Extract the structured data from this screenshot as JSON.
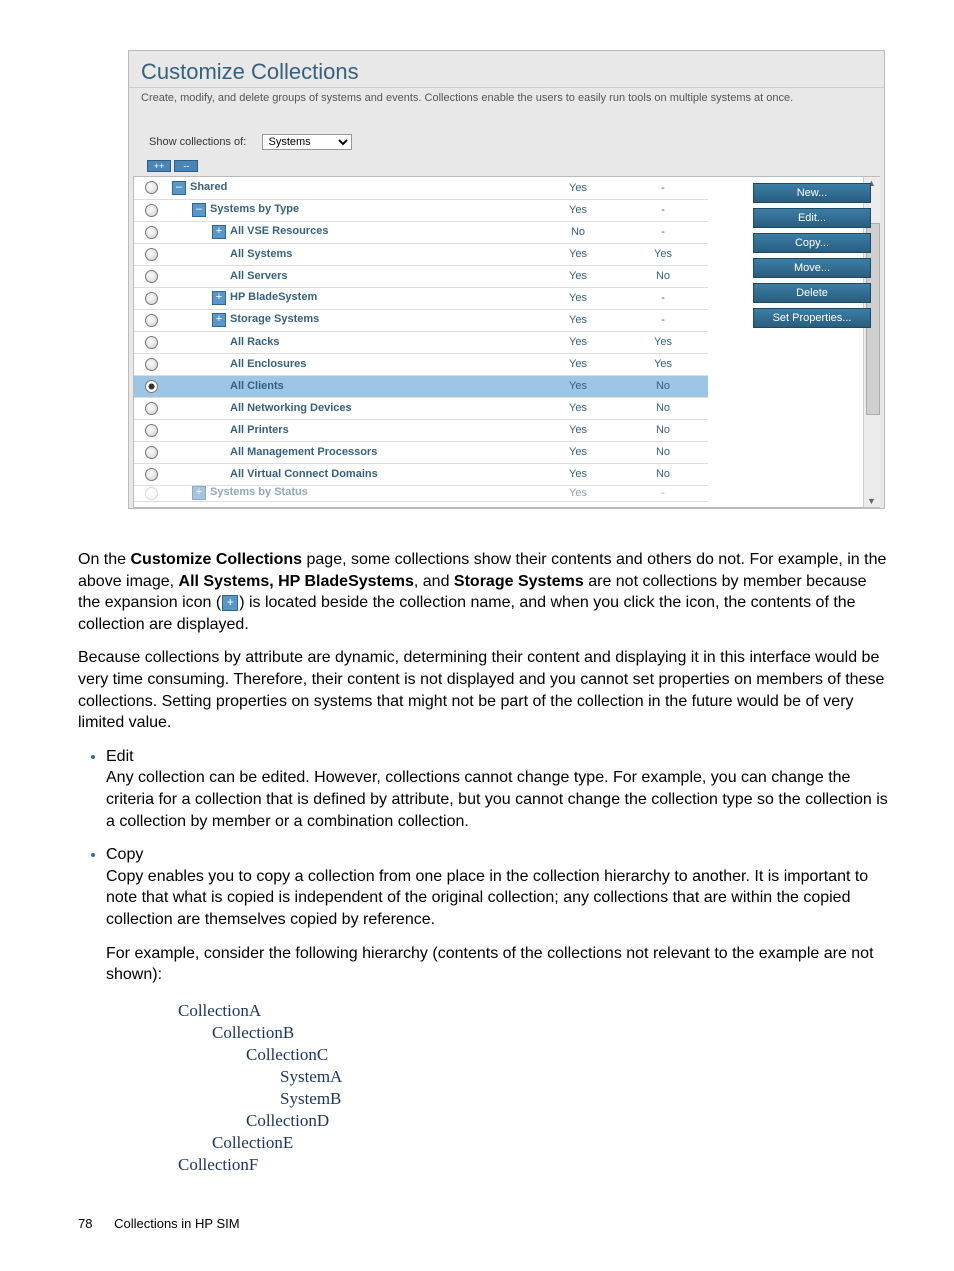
{
  "figure": {
    "title": "Customize Collections",
    "subtitle": "Create, modify, and delete groups of systems and events. Collections enable the users to easily run tools on multiple systems at once.",
    "show_label": "Show collections of:",
    "show_value": "Systems",
    "expand_all": "++",
    "collapse_all": "--",
    "rows": [
      {
        "indent": 0,
        "icon": "minus",
        "label": "Shared",
        "c3": "Yes",
        "c4": "-",
        "sel": false
      },
      {
        "indent": 1,
        "icon": "minus",
        "label": "Systems by Type",
        "c3": "Yes",
        "c4": "-",
        "sel": false
      },
      {
        "indent": 2,
        "icon": "plus",
        "label": "All VSE Resources",
        "c3": "No",
        "c4": "-",
        "sel": false
      },
      {
        "indent": 2,
        "icon": "",
        "label": "All Systems",
        "c3": "Yes",
        "c4": "Yes",
        "sel": false
      },
      {
        "indent": 2,
        "icon": "",
        "label": "All Servers",
        "c3": "Yes",
        "c4": "No",
        "sel": false
      },
      {
        "indent": 2,
        "icon": "plus",
        "label": "HP BladeSystem",
        "c3": "Yes",
        "c4": "-",
        "sel": false
      },
      {
        "indent": 2,
        "icon": "plus",
        "label": "Storage Systems",
        "c3": "Yes",
        "c4": "-",
        "sel": false
      },
      {
        "indent": 2,
        "icon": "",
        "label": "All Racks",
        "c3": "Yes",
        "c4": "Yes",
        "sel": false
      },
      {
        "indent": 2,
        "icon": "",
        "label": "All Enclosures",
        "c3": "Yes",
        "c4": "Yes",
        "sel": false
      },
      {
        "indent": 2,
        "icon": "",
        "label": "All Clients",
        "c3": "Yes",
        "c4": "No",
        "sel": true
      },
      {
        "indent": 2,
        "icon": "",
        "label": "All Networking Devices",
        "c3": "Yes",
        "c4": "No",
        "sel": false
      },
      {
        "indent": 2,
        "icon": "",
        "label": "All Printers",
        "c3": "Yes",
        "c4": "No",
        "sel": false
      },
      {
        "indent": 2,
        "icon": "",
        "label": "All Management Processors",
        "c3": "Yes",
        "c4": "No",
        "sel": false
      },
      {
        "indent": 2,
        "icon": "",
        "label": "All Virtual Connect Domains",
        "c3": "Yes",
        "c4": "No",
        "sel": false
      },
      {
        "indent": 1,
        "icon": "plus",
        "label": "Systems by Status",
        "c3": "Yes",
        "c4": "-",
        "sel": false,
        "cut": true
      }
    ],
    "actions": [
      "New...",
      "Edit...",
      "Copy...",
      "Move...",
      "Delete",
      "Set Properties..."
    ]
  },
  "body": {
    "p1a": "On the ",
    "p1b": "Customize Collections",
    "p1c": " page, some collections show their contents and others do not. For example, in the above image, ",
    "p1d": "All Systems, HP BladeSystems",
    "p1e": ", and ",
    "p1f": "Storage Systems",
    "p1g": " are not collections by member because the expansion icon (",
    "p1h": ") is located beside the collection name, and when you click the icon, the contents of the collection are displayed.",
    "p2": "Because collections by attribute are dynamic, determining their content and displaying it in this interface would be very time consuming. Therefore, their content is not displayed and you cannot set properties on members of these collections. Setting properties on systems that might not be part of the collection in the future would be of very limited value.",
    "li_edit": "Edit",
    "edit_p": "Any collection can be edited. However, collections cannot change type. For example, you can change the criteria for a collection that is defined by attribute, but you cannot change the collection type so the collection is a collection by member or a combination collection.",
    "li_copy": "Copy",
    "copy_p1": "Copy enables you to copy a collection from one place in the collection hierarchy to another. It is important to note that what is copied is independent of the original collection; any collections that are within the copied collection are themselves copied by reference.",
    "copy_p2": "For example, consider the following hierarchy (contents of the collections not relevant to the example are not shown):"
  },
  "hierarchy": "CollectionA\n        CollectionB\n                CollectionC\n                        SystemA\n                        SystemB\n                CollectionD\n        CollectionE\nCollectionF",
  "footer": {
    "page": "78",
    "section": "Collections in HP SIM"
  }
}
